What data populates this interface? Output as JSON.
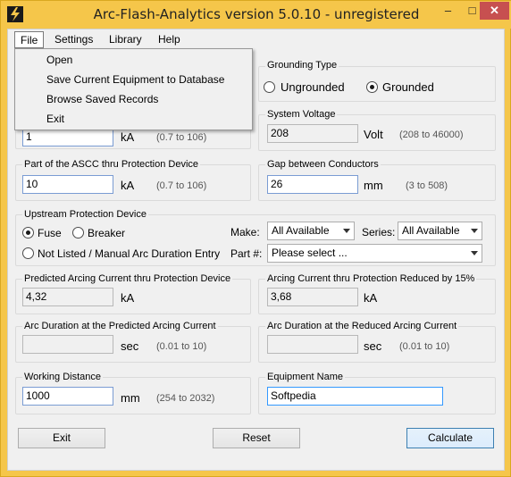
{
  "window": {
    "title": "Arc-Flash-Analytics version 5.0.10 - unregistered",
    "min_glyph": "–",
    "max_glyph": "□",
    "close_glyph": "✕"
  },
  "menubar": {
    "items": [
      "File",
      "Settings",
      "Library",
      "Help"
    ]
  },
  "file_menu": {
    "items": [
      "Open",
      "Save Current Equipment to Database",
      "Browse Saved Records",
      "Exit"
    ]
  },
  "grounding": {
    "label": "Grounding Type",
    "options": [
      "Ungrounded",
      "Grounded"
    ],
    "selected": "Grounded"
  },
  "ascc": {
    "value": "1",
    "unit": "kA",
    "range": "(0.7 to 106)"
  },
  "system_voltage": {
    "label": "System Voltage",
    "value": "208",
    "unit": "Volt",
    "range": "(208 to 46000)"
  },
  "ascc_thru": {
    "label": "Part of the ASCC thru Protection Device",
    "value": "10",
    "unit": "kA",
    "range": "(0.7 to 106)"
  },
  "gap": {
    "label": "Gap between Conductors",
    "value": "26",
    "unit": "mm",
    "range": "(3 to 508)"
  },
  "upstream": {
    "label": "Upstream Protection Device",
    "options": [
      "Fuse",
      "Breaker",
      "Not Listed / Manual Arc Duration Entry"
    ],
    "selected": "Fuse",
    "make_label": "Make:",
    "make_value": "All Available",
    "series_label": "Series:",
    "series_value": "All Available",
    "part_label": "Part #:",
    "part_value": "Please select ..."
  },
  "predicted": {
    "label": "Predicted Arcing Current thru Protection Device",
    "value": "4,32",
    "unit": "kA"
  },
  "reduced": {
    "label": "Arcing Current thru Protection Reduced by 15%",
    "value": "3,68",
    "unit": "kA"
  },
  "duration_pred": {
    "label": "Arc Duration at the Predicted Arcing Current",
    "value": "",
    "unit": "sec",
    "range": "(0.01 to 10)"
  },
  "duration_red": {
    "label": "Arc Duration at the Reduced Arcing Current",
    "value": "",
    "unit": "sec",
    "range": "(0.01 to 10)"
  },
  "working": {
    "label": "Working Distance",
    "value": "1000",
    "unit": "mm",
    "range": "(254 to 2032)"
  },
  "equipment": {
    "label": "Equipment Name",
    "value": "Softpedia"
  },
  "buttons": {
    "exit": "Exit",
    "reset": "Reset",
    "calculate": "Calculate"
  }
}
